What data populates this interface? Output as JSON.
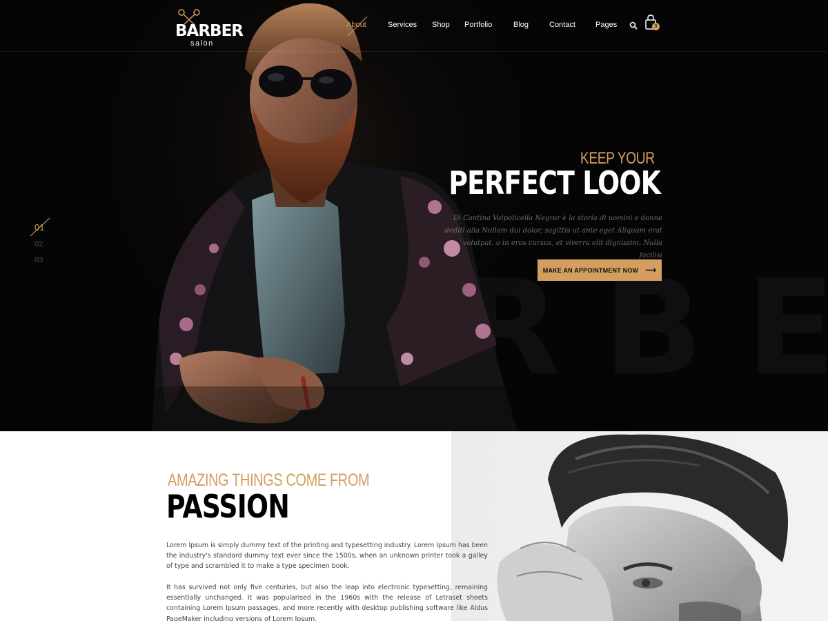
{
  "brand": {
    "logo_text": "BARBER",
    "logo_sub": "salon",
    "accent": "#d39e5f"
  },
  "nav": {
    "items": [
      "About",
      "Services",
      "Shop",
      "Portfolio",
      "Blog",
      "Contact",
      "Pages"
    ],
    "active": "About",
    "search_icon": "search-icon",
    "cart_icon": "shopping-bag-icon",
    "cart_count": "0"
  },
  "hero": {
    "kicker": "KEEP YOUR",
    "title": "PERFECT LOOK",
    "description": "Di Cantina Valpolicella Negrar è la storia di uomini e donne dediti alla Nullam dui dolor, sagittis ut ante eget Aliquam erat volutpat. o in eros cursus, et viverra elit dignissim. Nulla facilisi",
    "cta_label": "MAKE AN APPOINTMENT NOW",
    "background_word": "BARBER",
    "slides": [
      "01",
      "02",
      "03"
    ],
    "active_slide": "01"
  },
  "about": {
    "kicker": "AMAZING THINGS COME FROM",
    "title": "PASSION",
    "paragraphs": [
      "Lorem Ipsum is simply dummy text of the printing and typesetting industry. Lorem Ipsum has been the industry's standard dummy text ever since the 1500s, when an unknown printer took a galley of type and scrambled it to make a type specimen book.",
      "It has survived not only five centuries, but also the leap into electronic typesetting, remaining essentially unchanged. It was popularised in the 1960s with the release of Letraset sheets containing Lorem Ipsum passages, and more recently with desktop publishing software like Aldus PageMaker including versions of Lorem Ipsum."
    ]
  }
}
